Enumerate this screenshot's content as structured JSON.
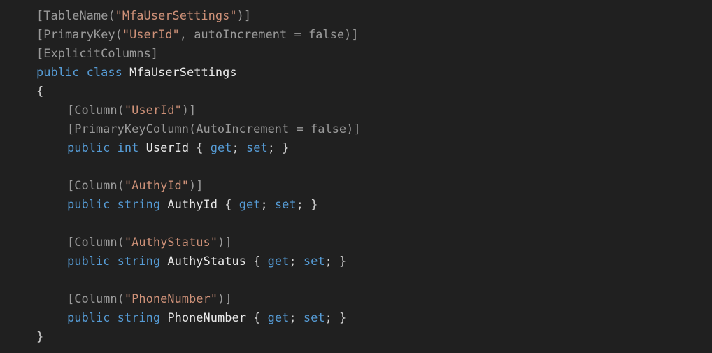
{
  "editor": {
    "language": "csharp",
    "background_color": "#202020",
    "colors": {
      "keyword": "#569cd6",
      "string": "#ce9178",
      "attribute": "#9a9a9a",
      "identifier": "#e8e8e8",
      "punctuation": "#d4d4d4"
    },
    "lines": [
      {
        "indent": 0,
        "tokens": [
          {
            "text": "[TableName(",
            "kind": "attr"
          },
          {
            "text": "\"MfaUserSettings\"",
            "kind": "string"
          },
          {
            "text": ")]",
            "kind": "attr"
          }
        ]
      },
      {
        "indent": 0,
        "tokens": [
          {
            "text": "[PrimaryKey(",
            "kind": "attr"
          },
          {
            "text": "\"UserId\"",
            "kind": "string"
          },
          {
            "text": ", autoIncrement = false)]",
            "kind": "attr"
          }
        ]
      },
      {
        "indent": 0,
        "tokens": [
          {
            "text": "[ExplicitColumns]",
            "kind": "attr"
          }
        ]
      },
      {
        "indent": 0,
        "tokens": [
          {
            "text": "public",
            "kind": "keyword"
          },
          {
            "text": " ",
            "kind": "plain"
          },
          {
            "text": "class",
            "kind": "keyword"
          },
          {
            "text": " ",
            "kind": "plain"
          },
          {
            "text": "MfaUserSettings",
            "kind": "ident"
          }
        ]
      },
      {
        "indent": 0,
        "tokens": [
          {
            "text": "{",
            "kind": "punct"
          }
        ]
      },
      {
        "indent": 4,
        "tokens": [
          {
            "text": "[Column(",
            "kind": "attr"
          },
          {
            "text": "\"UserId\"",
            "kind": "string"
          },
          {
            "text": ")]",
            "kind": "attr"
          }
        ]
      },
      {
        "indent": 4,
        "tokens": [
          {
            "text": "[PrimaryKeyColumn(AutoIncrement = false)]",
            "kind": "attr"
          }
        ]
      },
      {
        "indent": 4,
        "tokens": [
          {
            "text": "public",
            "kind": "keyword"
          },
          {
            "text": " ",
            "kind": "plain"
          },
          {
            "text": "int",
            "kind": "keyword"
          },
          {
            "text": " ",
            "kind": "plain"
          },
          {
            "text": "UserId",
            "kind": "ident"
          },
          {
            "text": " { ",
            "kind": "punct"
          },
          {
            "text": "get",
            "kind": "keyword"
          },
          {
            "text": "; ",
            "kind": "punct"
          },
          {
            "text": "set",
            "kind": "keyword"
          },
          {
            "text": "; }",
            "kind": "punct"
          }
        ]
      },
      {
        "indent": 0,
        "blank": true,
        "tokens": []
      },
      {
        "indent": 4,
        "tokens": [
          {
            "text": "[Column(",
            "kind": "attr"
          },
          {
            "text": "\"AuthyId\"",
            "kind": "string"
          },
          {
            "text": ")]",
            "kind": "attr"
          }
        ]
      },
      {
        "indent": 4,
        "tokens": [
          {
            "text": "public",
            "kind": "keyword"
          },
          {
            "text": " ",
            "kind": "plain"
          },
          {
            "text": "string",
            "kind": "keyword"
          },
          {
            "text": " ",
            "kind": "plain"
          },
          {
            "text": "AuthyId",
            "kind": "ident"
          },
          {
            "text": " { ",
            "kind": "punct"
          },
          {
            "text": "get",
            "kind": "keyword"
          },
          {
            "text": "; ",
            "kind": "punct"
          },
          {
            "text": "set",
            "kind": "keyword"
          },
          {
            "text": "; }",
            "kind": "punct"
          }
        ]
      },
      {
        "indent": 0,
        "blank": true,
        "tokens": []
      },
      {
        "indent": 4,
        "tokens": [
          {
            "text": "[Column(",
            "kind": "attr"
          },
          {
            "text": "\"AuthyStatus\"",
            "kind": "string"
          },
          {
            "text": ")]",
            "kind": "attr"
          }
        ]
      },
      {
        "indent": 4,
        "tokens": [
          {
            "text": "public",
            "kind": "keyword"
          },
          {
            "text": " ",
            "kind": "plain"
          },
          {
            "text": "string",
            "kind": "keyword"
          },
          {
            "text": " ",
            "kind": "plain"
          },
          {
            "text": "AuthyStatus",
            "kind": "ident"
          },
          {
            "text": " { ",
            "kind": "punct"
          },
          {
            "text": "get",
            "kind": "keyword"
          },
          {
            "text": "; ",
            "kind": "punct"
          },
          {
            "text": "set",
            "kind": "keyword"
          },
          {
            "text": "; }",
            "kind": "punct"
          }
        ]
      },
      {
        "indent": 0,
        "blank": true,
        "tokens": []
      },
      {
        "indent": 4,
        "tokens": [
          {
            "text": "[Column(",
            "kind": "attr"
          },
          {
            "text": "\"PhoneNumber\"",
            "kind": "string"
          },
          {
            "text": ")]",
            "kind": "attr"
          }
        ]
      },
      {
        "indent": 4,
        "tokens": [
          {
            "text": "public",
            "kind": "keyword"
          },
          {
            "text": " ",
            "kind": "plain"
          },
          {
            "text": "string",
            "kind": "keyword"
          },
          {
            "text": " ",
            "kind": "plain"
          },
          {
            "text": "PhoneNumber",
            "kind": "ident"
          },
          {
            "text": " { ",
            "kind": "punct"
          },
          {
            "text": "get",
            "kind": "keyword"
          },
          {
            "text": "; ",
            "kind": "punct"
          },
          {
            "text": "set",
            "kind": "keyword"
          },
          {
            "text": "; }",
            "kind": "punct"
          }
        ]
      },
      {
        "indent": 0,
        "tokens": [
          {
            "text": "}",
            "kind": "punct"
          }
        ]
      }
    ]
  }
}
